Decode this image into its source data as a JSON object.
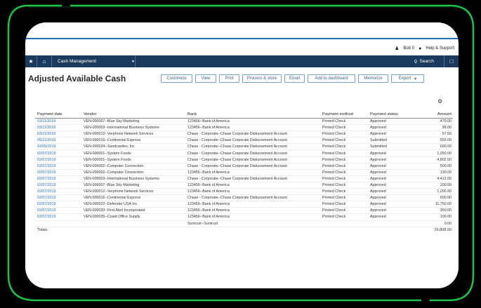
{
  "frame": {
    "accent_color": "#1ec24a"
  },
  "utility": {
    "user": "Bob 0",
    "help": "Help & Support",
    "user_icon": "user-icon",
    "chat_icon": "chat-icon"
  },
  "nav": {
    "module": "Cash Management",
    "search": "Search"
  },
  "page": {
    "title": "Adjusted Available Cash"
  },
  "toolbar": {
    "buttons": [
      "Customize",
      "View",
      "Print",
      "Process & store",
      "Email",
      "Add to dashboard",
      "Memorize",
      "Export"
    ]
  },
  "table": {
    "columns": [
      "Payment date",
      "Vendor",
      "Bank",
      "Payment method",
      "Payment status",
      "Amount"
    ],
    "rows": [
      [
        "03/11/2018",
        "VEN-000007--Blue Sky Marketing",
        "123456--Bank of America",
        "Printed Check",
        "Approved",
        "470.00"
      ],
      [
        "03/11/2018",
        "VEN-000003--International Business Systems",
        "123456--Bank of America",
        "Printed Check",
        "Approved",
        "99.00"
      ],
      [
        "03/11/2018",
        "VEN-000012--Verphone Network Services",
        "Chase - Corporate--Chase Corporate Disbursement Account",
        "Printed Check",
        "Approved",
        "57.50"
      ],
      [
        "05/11/2018",
        "VEN-000016--Continental Express",
        "Chase - Corporate--Chase Corporate Disbursement Account",
        "Printed Check",
        "Submitted",
        "555.00"
      ],
      [
        "02/05/2019",
        "VEN-000024--Sandcastles, Inc",
        "Chase - Corporate--Chase Corporate Disbursement Account",
        "Printed Check",
        "Submitted",
        "600.00"
      ],
      [
        "02/07/2019",
        "VEN-000001--System Foods",
        "Chase - Corporate--Chase Corporate Disbursement Account",
        "Printed Check",
        "Approved",
        "1,250.00"
      ],
      [
        "02/07/2019",
        "VEN-000001--System Foods",
        "Chase - Corporate--Chase Corporate Disbursement Account",
        "Printed Check",
        "Approved",
        "4,802.50"
      ],
      [
        "02/07/2019",
        "VEN-000002--Computer Connection",
        "Chase - Corporate--Chase Corporate Disbursement Account",
        "Printed Check",
        "Approved",
        "500.00"
      ],
      [
        "02/07/2019",
        "VEN-000002--Computer Connection",
        "123456--Bank of America",
        "Printed Check",
        "Approved",
        "130.00"
      ],
      [
        "02/07/2019",
        "VEN-000003--International Business Systems",
        "Chase - Corporate--Chase Corporate Disbursement Account",
        "Printed Check",
        "Approved",
        "4,413.00"
      ],
      [
        "02/07/2019",
        "VEN-000007--Blue Sky Marketing",
        "123456--Bank of America",
        "Printed Check",
        "Approved",
        "200.00"
      ],
      [
        "02/07/2019",
        "VEN-000012--Verphone Network Services",
        "123456--Bank of America",
        "Printed Check",
        "Approved",
        "1,200.00"
      ],
      [
        "02/07/2019",
        "VEN-000016--Continental Express",
        "Chase - Corporate--Chase Corporate Disbursement Account",
        "Printed Check",
        "Approved",
        "600.00"
      ],
      [
        "02/07/2019",
        "VEN-000022--Defender USA Inc",
        "123456--Bank of America",
        "Printed Check",
        "Approved",
        "11,750.00"
      ],
      [
        "02/07/2019",
        "VEN-000033--First Alert Incorporated",
        "123456--Bank of America",
        "Printed Check",
        "Approved",
        "350.00"
      ],
      [
        "02/07/2019",
        "VEN-000035--Coast Office Supply",
        "123456--Bank of America",
        "Printed Check",
        "Approved",
        "100.00"
      ],
      [
        "",
        "",
        "Suntrust--Suntrust",
        "",
        "",
        "0.00"
      ]
    ],
    "totals_label": "Totals",
    "totals_amount": "26,808.00"
  }
}
